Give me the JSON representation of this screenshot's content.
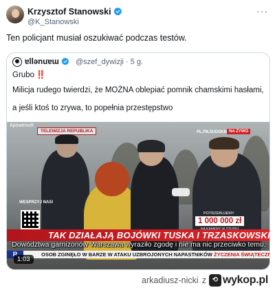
{
  "tweet": {
    "author_name": "Krzysztof Stanowski",
    "author_handle": "@K_Stanowski",
    "text": "Ten policjant musiał oszukiwać podczas testów.",
    "more_icon": "more-horizontal-icon",
    "verified_color": "#1d9bf0"
  },
  "quote": {
    "author_name": "ɐllǝnuɐɯ",
    "author_handle": "@szef_dywizji",
    "time": "· 5 g.",
    "line1": "Grubo",
    "line1_emoji": "‼️",
    "line2": "Milicja rudego twierdzi, że MOŻNA oblepiać pomnik chamskimi hasłami,",
    "line3": "a jeśli ktoś to zrywa, to popełnia przestępstwo"
  },
  "video": {
    "watermark_source": "Apowersoft",
    "channel_logo": "TELEWIZJA REPUBLIKA",
    "location": "PL.PIŁSUDSKIEGO",
    "live_badge": "NA ŻYWO",
    "donate_label": "WESPRZYJ NAS!",
    "counter_label": "POTRZEBUJEMY",
    "counter_amount": "1 000 000 zł",
    "counter_sub": "NA KAMERY W STUDIU",
    "progress_text": "4%",
    "progress_fraction": 0.04,
    "headline": "TAK DZIAŁAJĄ BOJÓWKI TUSKA I TRZASKOWSKIEGO",
    "subtitle": "Dowództwa garnizonów Warszawa wyraziło zgodę i nie ma nic przeciwko temu,",
    "ticker_logo": "R",
    "ticker_text": "OSOB ZGINĘŁO W BARZE W ATAKU UZBROJONYCH NAPASTNIKÓW",
    "ticker_right": "ŻYCZENIA ŚWIĄTECZNE PIO",
    "duration": "1:03",
    "accent_red": "#c01818"
  },
  "watermark": {
    "user": "arkadiusz-nicki",
    "connector": "z",
    "site": "wykop.pl"
  }
}
